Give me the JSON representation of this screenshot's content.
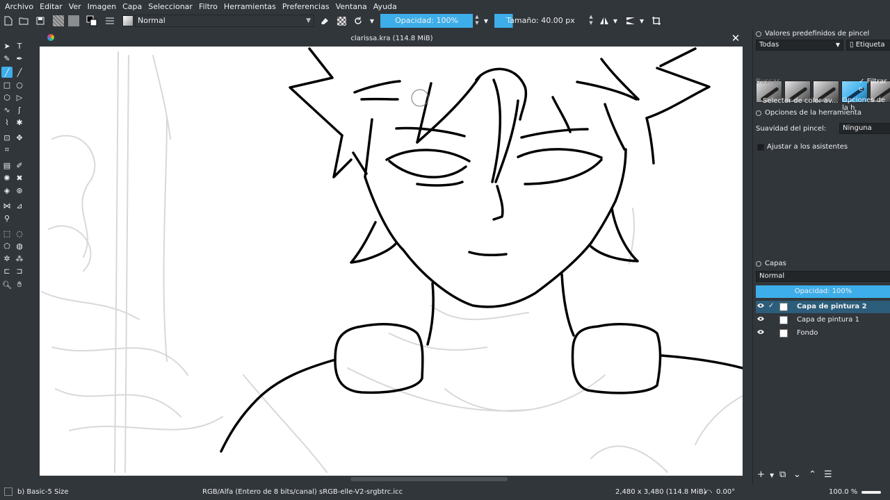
{
  "menu": [
    "Archivo",
    "Editar",
    "Ver",
    "Imagen",
    "Capa",
    "Seleccionar",
    "Filtro",
    "Herramientas",
    "Preferencias",
    "Ventana",
    "Ayuda"
  ],
  "toolbar": {
    "blend_mode": "Normal",
    "opacity_label": "Opacidad: 100%",
    "opacity_value": 1.0,
    "size_label": "Tamaño: 40.00 px"
  },
  "document": {
    "title": "clarissa.kra (114.8 MiB)",
    "close": "✕"
  },
  "brush_presets": {
    "title": "Valores predefinidos de pincel",
    "filter": "Todas",
    "tag": "Etiqueta",
    "search_placeholder": "Buscar",
    "filter_check": "Filtrar e"
  },
  "tool_options": {
    "tab_color": "Selector de color av...",
    "tab_options": "Opciones de la h",
    "title": "Opciones de la herramienta",
    "smoothing_label": "Suavidad del pincel:",
    "smoothing_value": "Ninguna",
    "assistants_label": "Ajustar a los asistentes"
  },
  "layers": {
    "title": "Capas",
    "blend_mode": "Normal",
    "opacity_label": "Opacidad: 100%",
    "items": [
      {
        "name": "Capa de pintura 2",
        "selected": true
      },
      {
        "name": "Capa de pintura 1",
        "selected": false
      },
      {
        "name": "Fondo",
        "selected": false
      }
    ]
  },
  "status": {
    "brush": "b) Basic-5 Size",
    "color_space": "RGB/Alfa (Entero de 8 bits/canal)  sRGB-elle-V2-srgbtrc.icc",
    "dimensions": "2,480 x 3,480 (114.8 MiB)",
    "rotation": "0.00°",
    "zoom": "100.0 %"
  },
  "colors": {
    "accent": "#3daee9",
    "background": "#31363b"
  }
}
